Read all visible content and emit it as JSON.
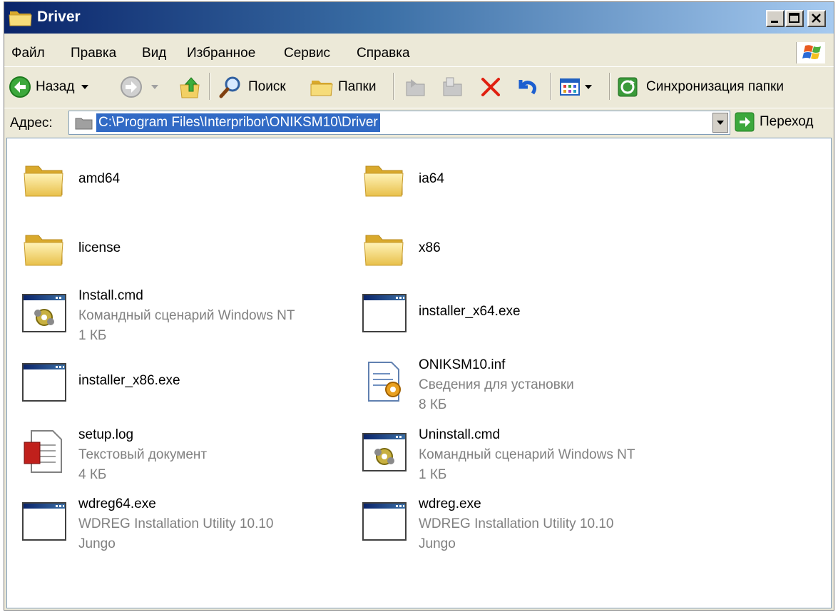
{
  "window": {
    "title": "Driver"
  },
  "menu": {
    "items": [
      "Файл",
      "Правка",
      "Вид",
      "Избранное",
      "Сервис",
      "Справка"
    ]
  },
  "toolbar": {
    "back_label": "Назад",
    "search_label": "Поиск",
    "folders_label": "Папки",
    "sync_label": "Синхронизация папки"
  },
  "address": {
    "label": "Адрес:",
    "path": "C:\\Program Files\\Interpribor\\ONIKSM10\\Driver",
    "go_label": "Переход"
  },
  "files": [
    {
      "name": "amd64",
      "type": "",
      "size": "",
      "icon": "folder-icon"
    },
    {
      "name": "ia64",
      "type": "",
      "size": "",
      "icon": "folder-icon"
    },
    {
      "name": "license",
      "type": "",
      "size": "",
      "icon": "folder-icon"
    },
    {
      "name": "x86",
      "type": "",
      "size": "",
      "icon": "folder-icon"
    },
    {
      "name": "Install.cmd",
      "type": "Командный сценарий Windows NT",
      "size": "1 КБ",
      "icon": "cmd-script-icon"
    },
    {
      "name": "installer_x64.exe",
      "type": "",
      "size": "",
      "icon": "exe-icon"
    },
    {
      "name": "installer_x86.exe",
      "type": "",
      "size": "",
      "icon": "exe-icon"
    },
    {
      "name": "ONIKSM10.inf",
      "type": "Сведения для установки",
      "size": "8 КБ",
      "icon": "inf-icon"
    },
    {
      "name": "setup.log",
      "type": "Текстовый документ",
      "size": "4 КБ",
      "icon": "text-document-icon"
    },
    {
      "name": "Uninstall.cmd",
      "type": "Командный сценарий Windows NT",
      "size": "1 КБ",
      "icon": "cmd-script-icon"
    },
    {
      "name": "wdreg64.exe",
      "type": "WDREG Installation Utility 10.10",
      "size": "Jungo",
      "icon": "exe-icon"
    },
    {
      "name": "wdreg.exe",
      "type": "WDREG Installation Utility 10.10",
      "size": "Jungo",
      "icon": "exe-icon"
    }
  ]
}
